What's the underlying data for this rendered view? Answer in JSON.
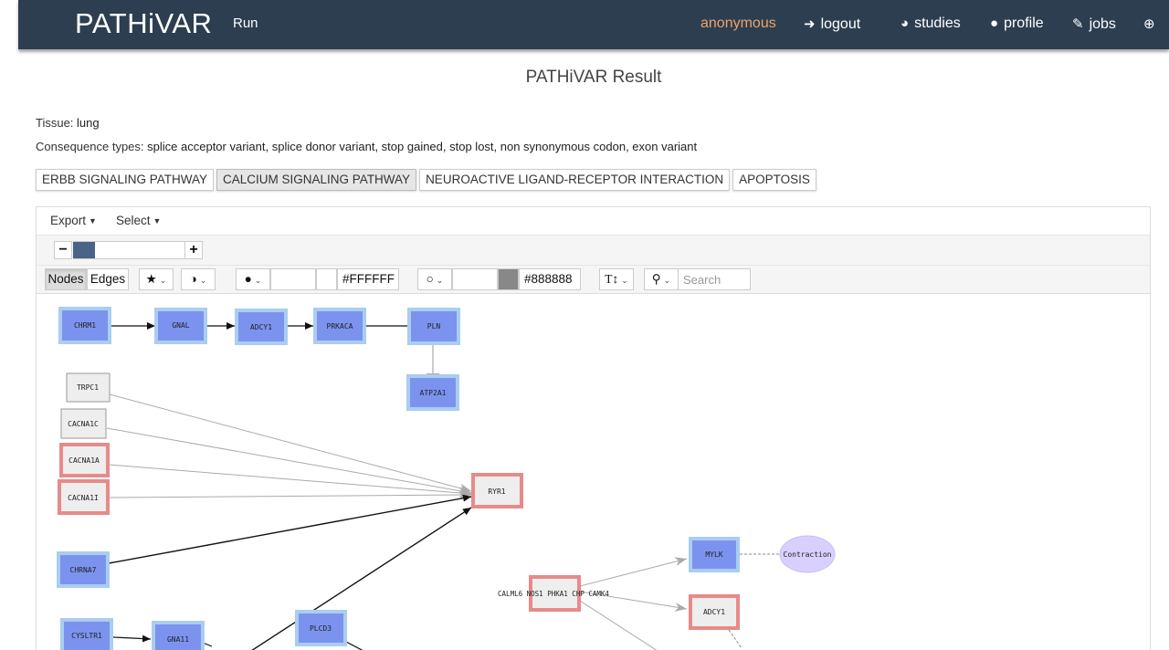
{
  "header": {
    "brand": "PATHiVAR",
    "run": "Run",
    "user": "anonymous",
    "logout": "logout",
    "studies": "studies",
    "profile": "profile",
    "jobs": "jobs"
  },
  "page": {
    "title": "PATHiVAR Result",
    "tissue_label": "Tissue:",
    "tissue": "lung",
    "consequence_label": "Consequence types:",
    "consequences": "splice acceptor variant, splice donor variant, stop gained, stop lost, non synonymous codon, exon variant"
  },
  "tabs": [
    {
      "label": "ERBB SIGNALING PATHWAY",
      "active": false
    },
    {
      "label": "CALCIUM SIGNALING PATHWAY",
      "active": true
    },
    {
      "label": "NEUROACTIVE LIGAND-RECEPTOR INTERACTION",
      "active": false
    },
    {
      "label": "APOPTOSIS",
      "active": false
    }
  ],
  "toolbar": {
    "export": "Export",
    "select": "Select",
    "zoom_minus": "−",
    "zoom_plus": "+",
    "zoom_level": 0.2,
    "nodes": "Nodes",
    "edges": "Edges",
    "fill_color": "#FFFFFF",
    "stroke_color": "#888888",
    "search_placeholder": "Search"
  },
  "colors": {
    "navbar": "#2c3e50",
    "user": "#f0a26a",
    "blue_node": "#7b93ef",
    "blue_border": "#aacdf0",
    "red_border": "#e88a8a",
    "grey_node": "#eeeeee",
    "phenotype": "#d9d0ff"
  },
  "network": {
    "nodes": [
      {
        "id": "n1",
        "label": "CHRM1",
        "style": "blue"
      },
      {
        "id": "n2",
        "label": "GNAL",
        "style": "blue"
      },
      {
        "id": "n3",
        "label": "ADCY1",
        "style": "blue"
      },
      {
        "id": "n4",
        "label": "PRKACA",
        "style": "blue"
      },
      {
        "id": "n5",
        "label": "PLN",
        "style": "blue"
      },
      {
        "id": "n6",
        "label": "ATP2A1",
        "style": "blue"
      },
      {
        "id": "n7",
        "label": "TRPC1",
        "style": "grey"
      },
      {
        "id": "n8",
        "label": "CACNA1C",
        "style": "grey"
      },
      {
        "id": "n9",
        "label": "CACNA1A",
        "style": "red"
      },
      {
        "id": "n10",
        "label": "CACNA1I",
        "style": "red"
      },
      {
        "id": "n11",
        "label": "RYR1",
        "style": "red"
      },
      {
        "id": "n12",
        "label": "CHRNA7",
        "style": "blue"
      },
      {
        "id": "n13",
        "label": "CALML6 NOS1 PHKA1 CHP CAMK4",
        "style": "red"
      },
      {
        "id": "n14",
        "label": "MYLK",
        "style": "blue"
      },
      {
        "id": "n15",
        "label": "Contraction",
        "style": "phenotype"
      },
      {
        "id": "n16",
        "label": "ADCY1",
        "style": "red"
      },
      {
        "id": "n17",
        "label": "CYSLTR1",
        "style": "blue"
      },
      {
        "id": "n18",
        "label": "GNA11",
        "style": "blue"
      },
      {
        "id": "n19",
        "label": "PLCD3",
        "style": "blue"
      }
    ]
  }
}
